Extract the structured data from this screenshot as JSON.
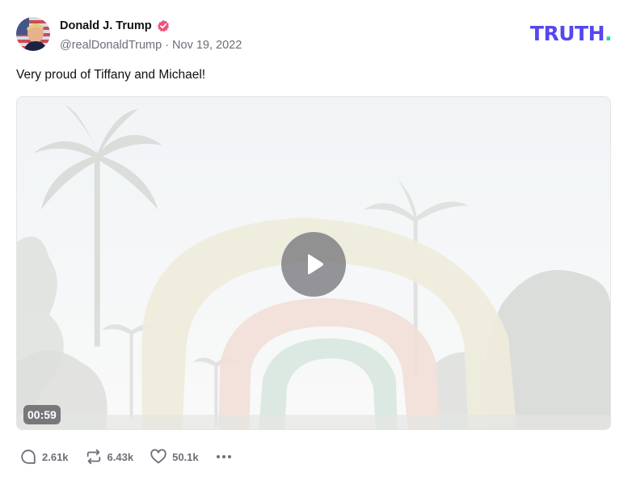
{
  "author": {
    "name": "Donald J. Trump",
    "handle": "@realDonaldTrump",
    "separator": "·",
    "date": "Nov 19, 2022"
  },
  "logo": {
    "text": "TRUTH",
    "dot": ".",
    "brand_color": "#5448ee",
    "dot_color": "#17d4b0"
  },
  "post": {
    "text": "Very proud of Tiffany and Michael!"
  },
  "video": {
    "duration": "00:59"
  },
  "actions": {
    "replies": "2.61k",
    "retruths": "6.43k",
    "likes": "50.1k"
  },
  "icons": {
    "verified": "verified-badge-icon",
    "play": "play-icon",
    "reply": "reply-icon",
    "retruth": "retruth-icon",
    "like": "heart-icon",
    "more": "more-dots-icon"
  },
  "colors": {
    "verified": "#f0527a",
    "muted": "#6b6f78"
  }
}
